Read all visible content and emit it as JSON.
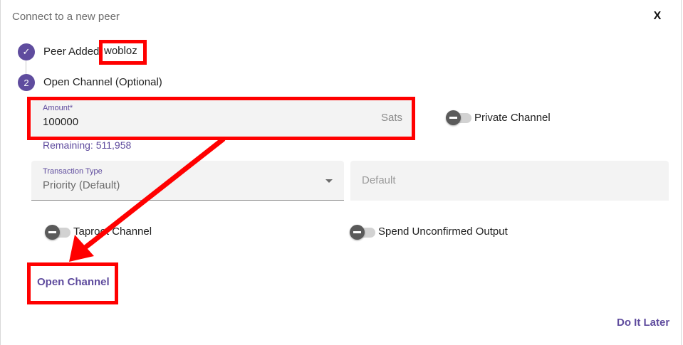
{
  "dialog": {
    "title": "Connect to a new peer",
    "close_label": "X"
  },
  "steps": [
    {
      "marker": "✓",
      "label": "Peer Added:",
      "value": "wobloz"
    },
    {
      "marker": "2",
      "label": "Open Channel (Optional)"
    }
  ],
  "amount_field": {
    "label": "Amount*",
    "value": "100000",
    "suffix": "Sats",
    "hint": "Remaining: 511,958"
  },
  "toggles": {
    "private_channel": "Private Channel",
    "taproot_channel": "Taproot Channel",
    "spend_unconfirmed": "Spend Unconfirmed Output"
  },
  "transaction_type": {
    "label": "Transaction Type",
    "value": "Priority (Default)"
  },
  "fee_field": {
    "placeholder": "Default"
  },
  "actions": {
    "open_channel": "Open Channel",
    "do_it_later": "Do It Later"
  },
  "colors": {
    "accent": "#5f4c9e",
    "annotation": "#ff0000"
  }
}
